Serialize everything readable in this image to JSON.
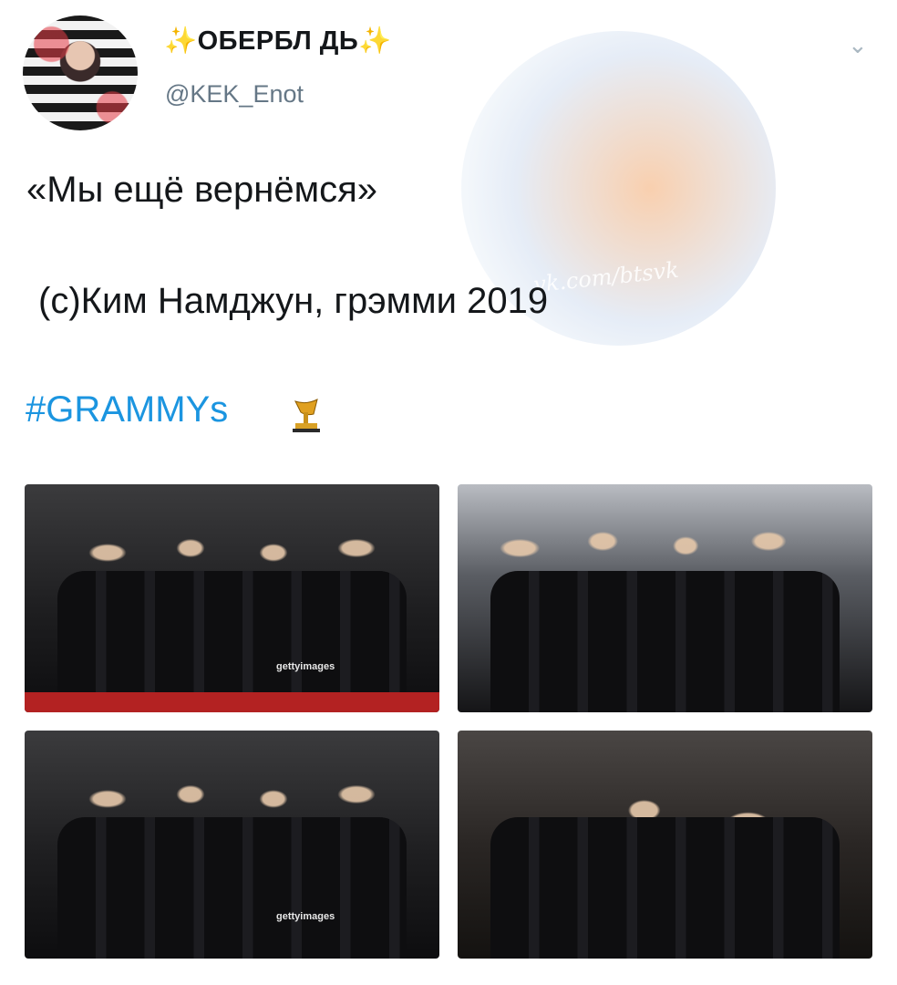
{
  "author": {
    "display_name": "✨ОБЕРБЛ ДЬ✨",
    "handle": "@KEK_Enot"
  },
  "tweet": {
    "line1": "«Мы ещё вернёмся»",
    "line2": "(с)Ким Намджун, грэмми 2019",
    "hashtag": "#GRAMMYs"
  },
  "watermark": "vk.com/btsvk",
  "photos": [
    {
      "alt": "group photo 1",
      "credit": "gettyimages"
    },
    {
      "alt": "group photo 2"
    },
    {
      "alt": "group photo 3",
      "credit": "gettyimages"
    },
    {
      "alt": "group photo 4"
    }
  ],
  "icons": {
    "menu": "chevron-down-icon",
    "trophy": "gramophone-trophy-icon"
  },
  "colors": {
    "link": "#1b95e0",
    "handle": "#657786"
  }
}
